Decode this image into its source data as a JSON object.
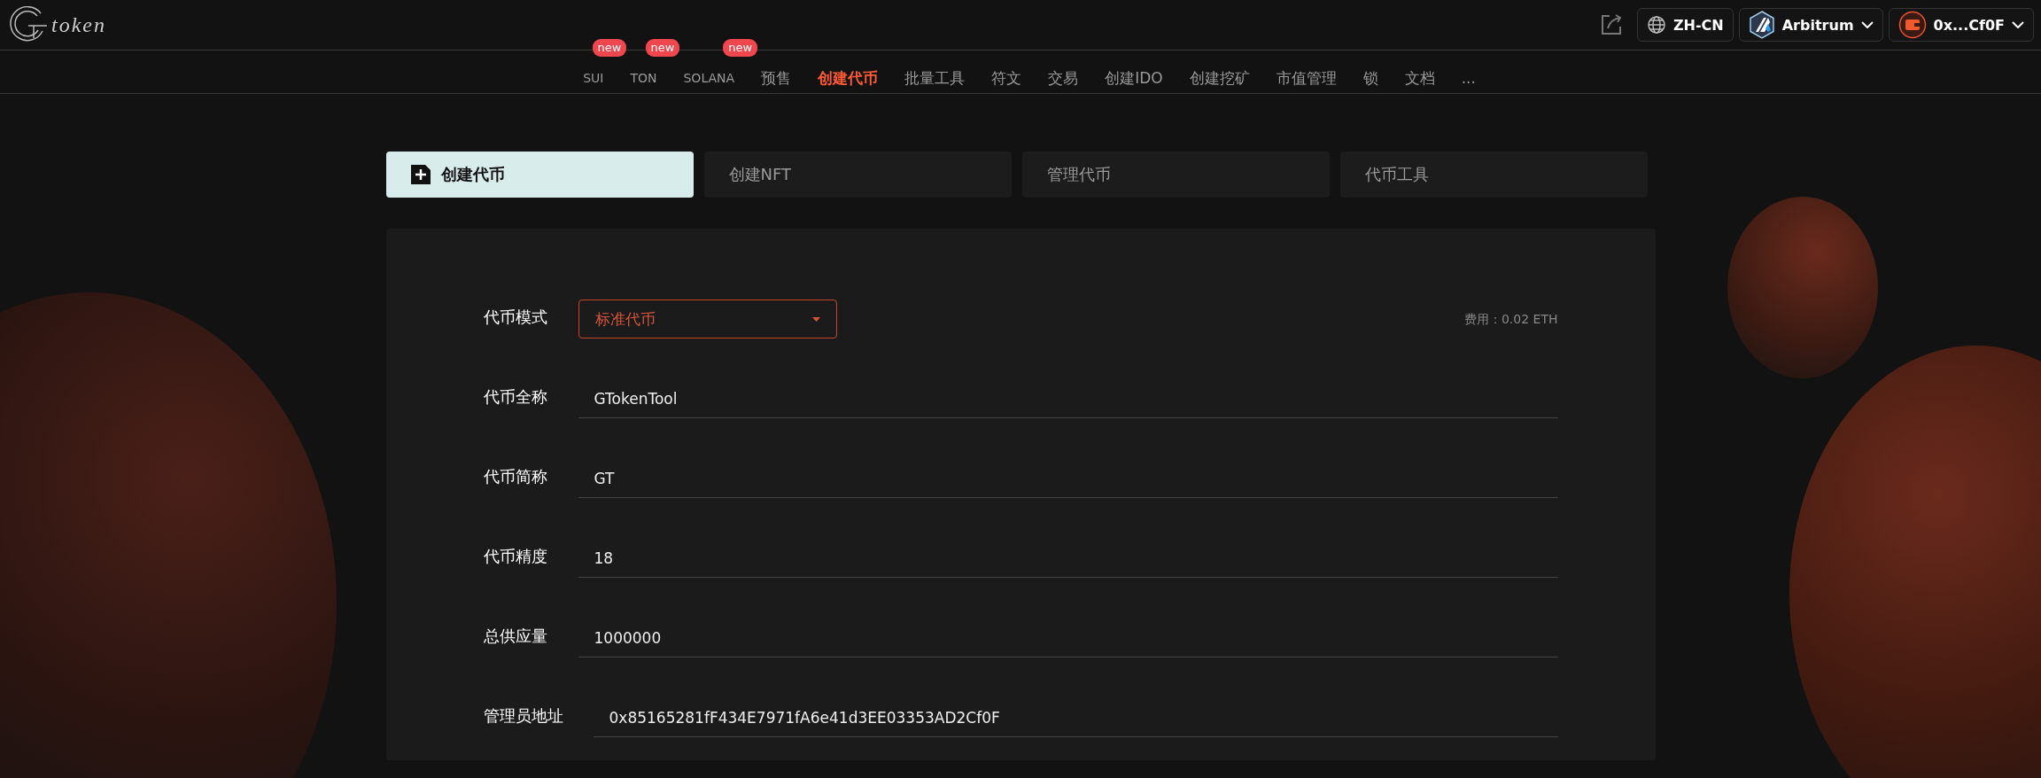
{
  "header": {
    "logo_text": "token",
    "language": "ZH-CN",
    "network": "Arbitrum",
    "wallet": "0x...Cf0F"
  },
  "nav": [
    {
      "label": "SUI",
      "selected": false,
      "badge": "new"
    },
    {
      "label": "TON",
      "selected": false,
      "badge": "new"
    },
    {
      "label": "SOLANA",
      "selected": false,
      "badge": "new"
    },
    {
      "label": "预售",
      "selected": false
    },
    {
      "label": "创建代币",
      "selected": true
    },
    {
      "label": "批量工具",
      "selected": false
    },
    {
      "label": "符文",
      "selected": false
    },
    {
      "label": "交易",
      "selected": false
    },
    {
      "label": "创建IDO",
      "selected": false
    },
    {
      "label": "创建挖矿",
      "selected": false
    },
    {
      "label": "市值管理",
      "selected": false
    },
    {
      "label": "锁",
      "selected": false
    },
    {
      "label": "文档",
      "selected": false
    },
    {
      "label": "...",
      "selected": false
    }
  ],
  "tabs": [
    {
      "label": "创建代币",
      "selected": true
    },
    {
      "label": "创建NFT",
      "selected": false
    },
    {
      "label": "管理代币",
      "selected": false
    },
    {
      "label": "代币工具",
      "selected": false
    }
  ],
  "form": [
    {
      "kind": "select",
      "label": "代币模式",
      "value": "标准代币",
      "fee": "费用：0.02 ETH"
    },
    {
      "kind": "text",
      "label": "代币全称",
      "value": "GTokenTool"
    },
    {
      "kind": "text",
      "label": "代币简称",
      "value": "GT"
    },
    {
      "kind": "text",
      "label": "代币精度",
      "value": "18"
    },
    {
      "kind": "text",
      "label": "总供应量",
      "value": "1000000"
    },
    {
      "kind": "text",
      "label": "管理员地址",
      "value": "0x85165281fF434E7971fA6e41d3EE03353AD2Cf0F"
    }
  ]
}
